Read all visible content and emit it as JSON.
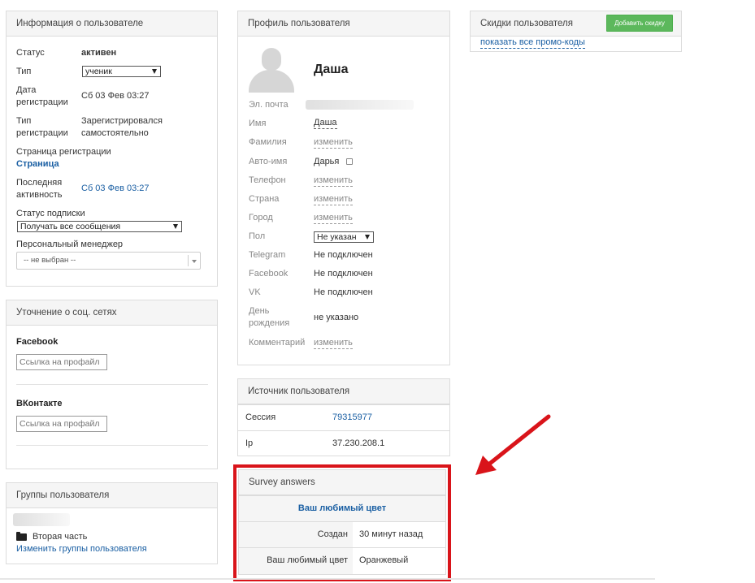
{
  "user_info": {
    "title": "Информация о пользователе",
    "status_label": "Статус",
    "status_value": "активен",
    "type_label": "Тип",
    "type_value": "ученик",
    "reg_date_label_1": "Дата",
    "reg_date_label_2": "регистрации",
    "reg_date_value": "Сб 03 Фев 03:27",
    "reg_type_label_1": "Тип",
    "reg_type_label_2": "регистрации",
    "reg_type_value_1": "Зарегистрировался",
    "reg_type_value_2": "самостоятельно",
    "reg_page_label": "Страница регистрации",
    "reg_page_link": "Страница",
    "last_activity_label_1": "Последняя",
    "last_activity_label_2": "активность",
    "last_activity_value": "Сб 03 Фев 03:27",
    "subscription_label": "Статус подписки",
    "subscription_value": "Получать все сообщения",
    "manager_label": "Персональный менеджер",
    "manager_value": "-- не выбран --"
  },
  "social": {
    "title": "Уточнение о соц. сетях",
    "facebook_label": "Facebook",
    "facebook_placeholder": "Ссылка на профайл",
    "vk_label": "ВКонтакте",
    "vk_placeholder": "Ссылка на профайл"
  },
  "groups": {
    "title": "Группы пользователя",
    "item": "Вторая часть",
    "change_link": "Изменить группы пользователя"
  },
  "profile": {
    "title": "Профиль пользователя",
    "name": "Даша",
    "email_label": "Эл. почта",
    "first_name_label": "Имя",
    "first_name_value": "Даша",
    "last_name_label": "Фамилия",
    "auto_name_label": "Авто-имя",
    "auto_name_value": "Дарья",
    "phone_label": "Телефон",
    "country_label": "Страна",
    "city_label": "Город",
    "gender_label": "Пол",
    "gender_value": "Не указан",
    "telegram_label": "Telegram",
    "telegram_value": "Не подключен",
    "facebook_label": "Facebook",
    "facebook_value": "Не подключен",
    "vk_label": "VK",
    "vk_value": "Не подключен",
    "birthday_label_1": "День",
    "birthday_label_2": "рождения",
    "birthday_value": "не указано",
    "comment_label": "Комментарий",
    "change_link": "изменить"
  },
  "source": {
    "title": "Источник пользователя",
    "session_label": "Сессия",
    "session_value": "79315977",
    "ip_label": "Ip",
    "ip_value": "37.230.208.1"
  },
  "survey": {
    "title": "Survey answers",
    "question": "Ваш любимый цвет",
    "created_label": "Создан",
    "created_value": "30 минут назад",
    "answer_label": "Ваш любимый цвет",
    "answer_value": "Оранжевый"
  },
  "discounts": {
    "title": "Скидки пользователя",
    "add_button": "Добавить скидку",
    "show_promos_link": "показать все промо-коды"
  },
  "colors": {
    "link": "#1a5fa3",
    "highlight": "#d9141a",
    "button": "#5cb85c"
  }
}
